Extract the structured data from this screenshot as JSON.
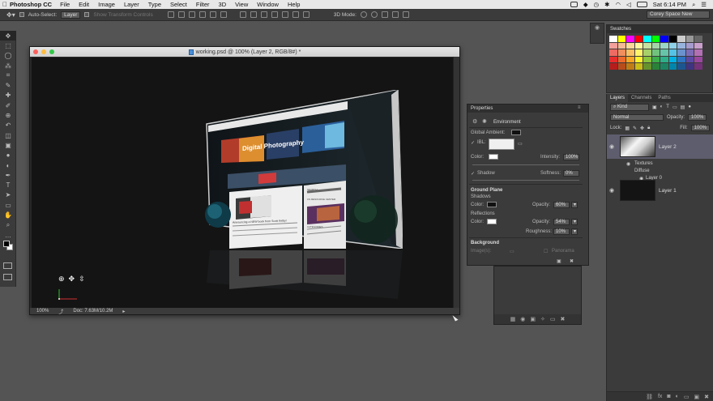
{
  "menubar": {
    "app_name": "Photoshop CC",
    "items": [
      "File",
      "Edit",
      "Image",
      "Layer",
      "Type",
      "Select",
      "Filter",
      "3D",
      "View",
      "Window",
      "Help"
    ],
    "clock": "Sat 6:14 PM"
  },
  "options": {
    "auto_select_label": "Auto-Select:",
    "auto_select_value": "Layer",
    "show_transform_label": "Show Transform Controls",
    "mode_label": "3D Mode:",
    "workspace": "Corey Space New"
  },
  "toolbar": {
    "tools": [
      "move-tool",
      "marquee-tool",
      "lasso-tool",
      "quick-select-tool",
      "crop-tool",
      "eyedropper-tool",
      "healing-tool",
      "brush-tool",
      "clone-stamp-tool",
      "history-brush-tool",
      "eraser-tool",
      "gradient-tool",
      "blur-tool",
      "dodge-tool",
      "pen-tool",
      "type-tool",
      "path-select-tool",
      "shape-tool",
      "hand-tool",
      "zoom-tool",
      "more-tool"
    ],
    "glyphs": [
      "✥",
      "⬚",
      "◯",
      "⁂",
      "⌗",
      "✎",
      "✚",
      "✐",
      "⊕",
      "↶",
      "◫",
      "▣",
      "●",
      "◐",
      "✒",
      "T",
      "➤",
      "▭",
      "✋",
      "⌕",
      "…"
    ]
  },
  "document": {
    "title": "working.psd @ 100% (Layer 2, RGB/8#) *",
    "zoom": "100%",
    "doc_info": "Doc: 7.63M/10.2M"
  },
  "postcard": {
    "site_name": "Digital Photography",
    "headline": "Announcing a NEW book from Scott Kelby!",
    "search_label": "SEARCH",
    "resource_label": "CS RESOURCE CENTER",
    "categories_label": "CATEGORIES"
  },
  "swatches": {
    "title": "Swatches",
    "colors": [
      "#ffffff",
      "#ffff00",
      "#ff00ff",
      "#ff0000",
      "#00ffff",
      "#00ff00",
      "#0000ff",
      "#000000",
      "#cccccc",
      "#999999",
      "#666666",
      "#f2a09b",
      "#f5b996",
      "#fbd89a",
      "#fff7a0",
      "#c6e0a0",
      "#a4d5a8",
      "#9ad6c6",
      "#8fd1e9",
      "#97b4dd",
      "#a59bcd",
      "#c99fcb",
      "#ed6b62",
      "#f08e5d",
      "#f8c063",
      "#fff46a",
      "#a7d06a",
      "#71c37c",
      "#66c4a9",
      "#56c2e6",
      "#6a93cd",
      "#7c6cb8",
      "#b36fb4",
      "#e62e2d",
      "#ec6a2d",
      "#f6a623",
      "#fff22f",
      "#8bc43f",
      "#3dae49",
      "#2eb08a",
      "#00b1e4",
      "#2e74c0",
      "#5a4aa6",
      "#9b479f",
      "#b41e1d",
      "#b84d1c",
      "#c07c15",
      "#cbbd17",
      "#67922e",
      "#2a8238",
      "#1d8463",
      "#0085ac",
      "#1d568f",
      "#3f3480",
      "#75327a"
    ]
  },
  "layers": {
    "tabs": [
      "Layers",
      "Channels",
      "Paths"
    ],
    "kind_label": "Kind",
    "blend_mode": "Normal",
    "opacity_label": "Opacity:",
    "opacity_value": "100%",
    "lock_label": "Lock:",
    "fill_label": "Fill:",
    "fill_value": "100%",
    "items": [
      {
        "name": "Layer 2",
        "selected": true
      },
      {
        "name": "Layer 1",
        "selected": false
      }
    ],
    "sub_textures": "Textures",
    "sub_diffuse": "Diffuse",
    "sub_layer0": "Layer 0",
    "footer_fx": "fx"
  },
  "properties": {
    "title": "Properties",
    "section": "Environment",
    "global_ambient_label": "Global Ambient:",
    "ibl_label": "IBL:",
    "color_label": "Color:",
    "intensity_label": "Intensity:",
    "intensity_value": "100%",
    "shadow_label": "Shadow",
    "softness_label": "Softness:",
    "softness_value": "0%",
    "ground_plane_label": "Ground Plane",
    "shadows_label": "Shadows",
    "shadows_color_label": "Color:",
    "shadows_opacity_label": "Opacity:",
    "shadows_opacity_value": "60%",
    "reflections_label": "Reflections",
    "reflections_color_label": "Color:",
    "reflections_opacity_label": "Opacity:",
    "reflections_opacity_value": "54%",
    "roughness_label": "Roughness:",
    "roughness_value": "10%",
    "background_label": "Background",
    "image_label": "Image(s):",
    "panorama_label": "Panorama"
  }
}
